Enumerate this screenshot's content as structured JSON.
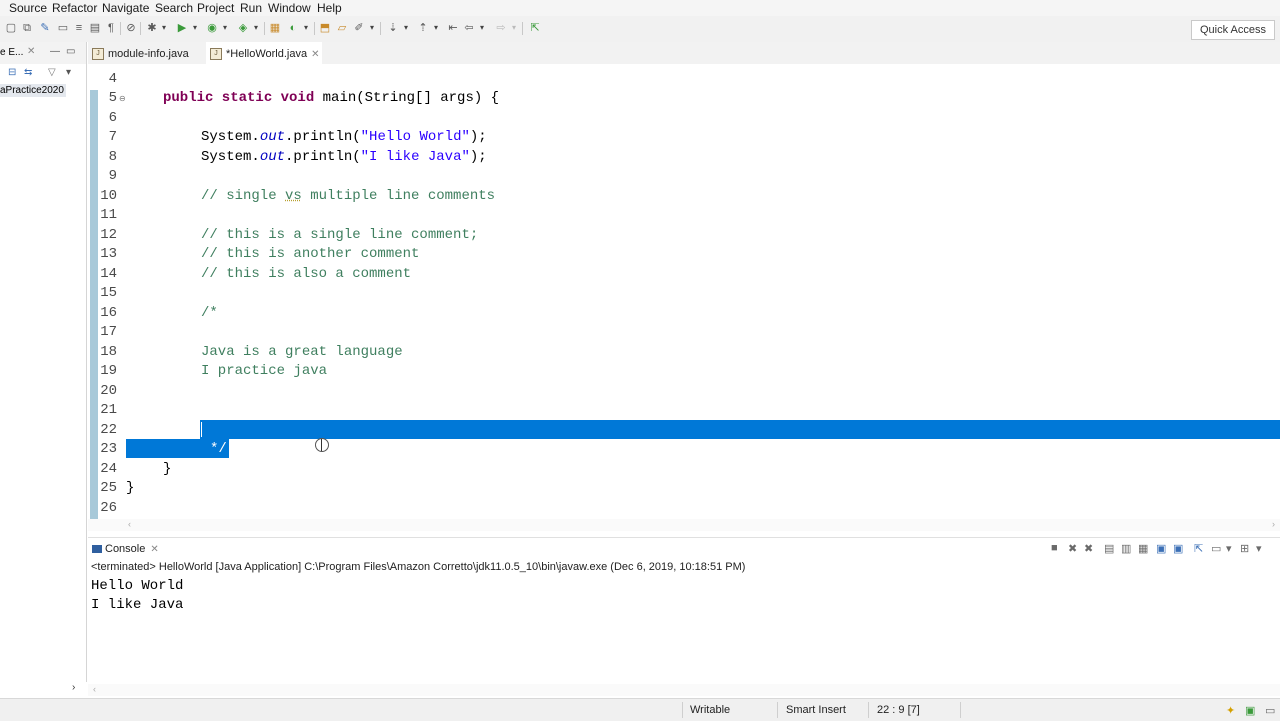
{
  "menu": [
    "Source",
    "Refactor",
    "Navigate",
    "Search",
    "Project",
    "Run",
    "Window",
    "Help"
  ],
  "quick_access": "Quick Access",
  "left_panel": {
    "title": "e E...",
    "project_item": "aPractice2020"
  },
  "editor_tabs": [
    {
      "label": "module-info.java",
      "active": false
    },
    {
      "label": "*HelloWorld.java",
      "active": true
    }
  ],
  "editor": {
    "line_numbers": [
      "4",
      "5",
      "6",
      "7",
      "8",
      "9",
      "10",
      "11",
      "12",
      "13",
      "14",
      "15",
      "16",
      "17",
      "18",
      "19",
      "20",
      "21",
      "22",
      "23",
      "24",
      "25",
      "26"
    ],
    "code": {
      "l5": {
        "kw": "public static void",
        "rest": " main(String[] args) {"
      },
      "l7": {
        "pre": "System.",
        "field": "out",
        "mid": ".println(",
        "str": "\"Hello World\"",
        "post": ");"
      },
      "l8": {
        "pre": "System.",
        "field": "out",
        "mid": ".println(",
        "str": "\"I like Java\"",
        "post": ");"
      },
      "l10": {
        "a": "// single ",
        "b": "vs",
        "c": " multiple line comments"
      },
      "l12": "// this is a single line comment;",
      "l13": "// this is another comment",
      "l14": "// this is also a comment",
      "l16": "/*",
      "l18": "Java is a great language",
      "l19": "I practice java",
      "l23": "*/",
      "l24": "}",
      "l25": "}"
    }
  },
  "console": {
    "tab_label": "Console",
    "status": "<terminated> HelloWorld [Java Application] C:\\Program Files\\Amazon Corretto\\jdk11.0.5_10\\bin\\javaw.exe (Dec 6, 2019, 10:18:51 PM)",
    "output": [
      "Hello World",
      "I like Java"
    ]
  },
  "statusbar": {
    "writable": "Writable",
    "insert_mode": "Smart Insert",
    "position": "22 : 9 [7]"
  },
  "colors": {
    "selection": "#0078d7",
    "keyword": "#7f0055",
    "string": "#2a00ff",
    "comment": "#3f7f5f",
    "field": "#0000c0"
  }
}
